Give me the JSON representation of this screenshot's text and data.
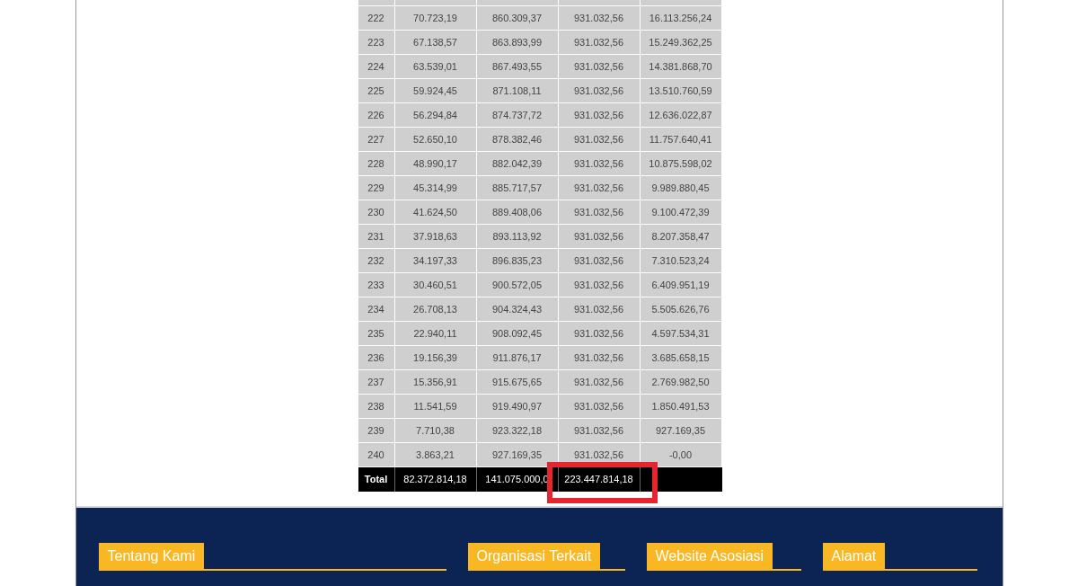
{
  "table": {
    "rows": [
      [
        "222",
        "70.723,19",
        "860.309,37",
        "931.032,56",
        "16.113.256,24"
      ],
      [
        "223",
        "67.138,57",
        "863.893,99",
        "931.032,56",
        "15.249.362,25"
      ],
      [
        "224",
        "63.539,01",
        "867.493,55",
        "931.032,56",
        "14.381.868,70"
      ],
      [
        "225",
        "59.924,45",
        "871.108,11",
        "931.032,56",
        "13.510.760,59"
      ],
      [
        "226",
        "56.294,84",
        "874.737,72",
        "931.032,56",
        "12.636.022,87"
      ],
      [
        "227",
        "52.650,10",
        "878.382,46",
        "931.032,56",
        "11.757.640,41"
      ],
      [
        "228",
        "48.990,17",
        "882.042,39",
        "931.032,56",
        "10.875.598,02"
      ],
      [
        "229",
        "45.314,99",
        "885.717,57",
        "931.032,56",
        "9.989.880,45"
      ],
      [
        "230",
        "41.624,50",
        "889.408,06",
        "931.032,56",
        "9.100.472,39"
      ],
      [
        "231",
        "37.918,63",
        "893.113,92",
        "931.032,56",
        "8.207.358,47"
      ],
      [
        "232",
        "34.197,33",
        "896.835,23",
        "931.032,56",
        "7.310.523,24"
      ],
      [
        "233",
        "30.460,51",
        "900.572,05",
        "931.032,56",
        "6.409.951,19"
      ],
      [
        "234",
        "26.708,13",
        "904.324,43",
        "931.032,56",
        "5.505.626,76"
      ],
      [
        "235",
        "22.940,11",
        "908.092,45",
        "931.032,56",
        "4.597.534,31"
      ],
      [
        "236",
        "19.156,39",
        "911.876,17",
        "931.032,56",
        "3.685.658,15"
      ],
      [
        "237",
        "15.356,91",
        "915.675,65",
        "931.032,56",
        "2.769.982,50"
      ],
      [
        "238",
        "11.541,59",
        "919.490,97",
        "931.032,56",
        "1.850.491,53"
      ],
      [
        "239",
        "7.710,38",
        "923.322,18",
        "931.032,56",
        "927.169,35"
      ],
      [
        "240",
        "3.863,21",
        "927.169,35",
        "931.032,56",
        "-0,00"
      ]
    ],
    "total_row": [
      "Total",
      "82.372.814,18",
      "141.075.000,0",
      "223.447.814,18"
    ]
  },
  "footer": {
    "headings": [
      "Tentang Kami",
      "Organisasi Terkait",
      "Website Asosiasi",
      "Alamat"
    ]
  }
}
